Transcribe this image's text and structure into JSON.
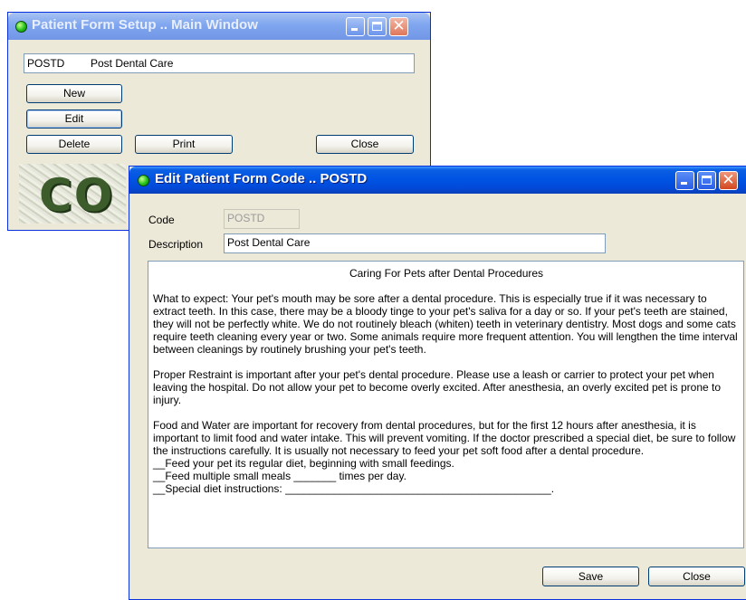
{
  "main_window": {
    "title": "Patient Form Setup .. Main Window",
    "list_code": "POSTD",
    "list_description": "Post Dental Care",
    "new_label": "New",
    "edit_label": "Edit",
    "delete_label": "Delete",
    "print_label": "Print",
    "close_label": "Close",
    "logo_text": "CO"
  },
  "edit_window": {
    "title": "Edit Patient Form Code .. POSTD",
    "code_label": "Code",
    "code_value": "POSTD",
    "description_label": "Description",
    "description_value": "Post Dental Care",
    "body": {
      "title": "Caring For Pets after Dental Procedures",
      "paragraph1": "What to expect: Your pet's mouth may be sore after a dental procedure. This is especially true if it was necessary to extract teeth. In this case, there may be a bloody tinge to your pet's saliva for a day or so. If your pet's teeth are stained, they will not be perfectly white. We do not routinely bleach (whiten) teeth in veterinary dentistry. Most dogs and some cats require teeth cleaning every year or two. Some animals require more frequent attention. You will lengthen the time interval between cleanings by routinely brushing your pet's teeth.",
      "paragraph2": "Proper Restraint is important after your pet's dental procedure. Please use a leash or carrier to protect your pet when leaving the hospital. Do not allow your pet to become overly excited. After anesthesia, an overly excited pet is prone to injury.",
      "paragraph3": "Food and Water are important for recovery from dental procedures, but for the first 12 hours after anesthesia, it is important to limit food and water intake. This will prevent vomiting. If the doctor prescribed a special diet, be sure to follow the instructions carefully. It is usually not necessary to feed your pet soft food after a dental procedure.",
      "line1": "__Feed your pet its regular diet, beginning with small feedings.",
      "line2": "__Feed multiple small meals _______ times per day.",
      "line3": "__Special diet instructions: ____________________________________________."
    },
    "save_label": "Save",
    "close_label": "Close"
  }
}
